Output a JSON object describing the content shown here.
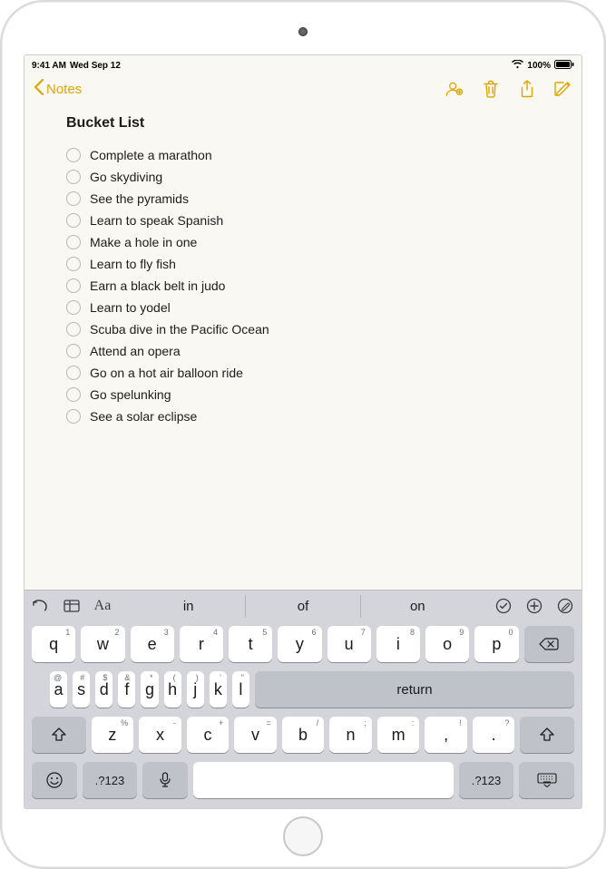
{
  "statusbar": {
    "time": "9:41 AM",
    "date": "Wed Sep 12",
    "battery": "100%"
  },
  "nav": {
    "back_label": "Notes"
  },
  "note": {
    "title": "Bucket List",
    "items": [
      "Complete a marathon",
      "Go skydiving",
      "See the pyramids",
      "Learn to speak Spanish",
      "Make a hole in one",
      "Learn to fly fish",
      "Earn a black belt in judo",
      "Learn to yodel",
      "Scuba dive in the Pacific Ocean",
      "Attend an opera",
      "Go on a hot air balloon ride",
      "Go spelunking",
      "See a solar eclipse"
    ]
  },
  "keyboard": {
    "suggestions": [
      "in",
      "of",
      "on"
    ],
    "row1": [
      {
        "k": "q",
        "s": "1"
      },
      {
        "k": "w",
        "s": "2"
      },
      {
        "k": "e",
        "s": "3"
      },
      {
        "k": "r",
        "s": "4"
      },
      {
        "k": "t",
        "s": "5"
      },
      {
        "k": "y",
        "s": "6"
      },
      {
        "k": "u",
        "s": "7"
      },
      {
        "k": "i",
        "s": "8"
      },
      {
        "k": "o",
        "s": "9"
      },
      {
        "k": "p",
        "s": "0"
      }
    ],
    "row2": [
      {
        "k": "a",
        "s": "@"
      },
      {
        "k": "s",
        "s": "#"
      },
      {
        "k": "d",
        "s": "$"
      },
      {
        "k": "f",
        "s": "&"
      },
      {
        "k": "g",
        "s": "*"
      },
      {
        "k": "h",
        "s": "("
      },
      {
        "k": "j",
        "s": ")"
      },
      {
        "k": "k",
        "s": "'"
      },
      {
        "k": "l",
        "s": "\""
      }
    ],
    "row3": [
      {
        "k": "z",
        "s": "%"
      },
      {
        "k": "x",
        "s": "-"
      },
      {
        "k": "c",
        "s": "+"
      },
      {
        "k": "v",
        "s": "="
      },
      {
        "k": "b",
        "s": "/"
      },
      {
        "k": "n",
        "s": ";"
      },
      {
        "k": "m",
        "s": ":"
      },
      {
        "k": ",",
        "s": "!"
      },
      {
        "k": ".",
        "s": "?"
      }
    ],
    "return_label": "return",
    "numkey_label": ".?123"
  }
}
